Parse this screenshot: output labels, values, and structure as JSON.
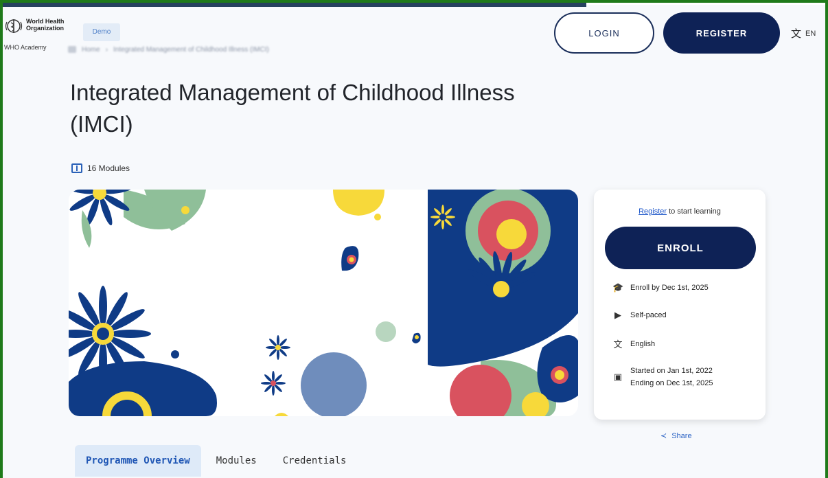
{
  "header": {
    "org_line1": "World Health",
    "org_line2": "Organization",
    "academy": "WHO Academy",
    "badge": "Demo",
    "breadcrumb": [
      "Home",
      "Integrated Management of Childhood Illness (IMCI)"
    ],
    "login": "LOGIN",
    "register": "REGISTER",
    "language": "EN"
  },
  "course": {
    "title": "Integrated Management of Childhood Illness (IMCI)",
    "modules": "16 Modules"
  },
  "card": {
    "register_link": "Register",
    "register_suffix": " to start learning",
    "enroll": "ENROLL",
    "enroll_by": "Enroll by Dec 1st, 2025",
    "pace": "Self-paced",
    "language": "English",
    "started": "Started on Jan 1st, 2022",
    "ending": "Ending on Dec 1st, 2025"
  },
  "share": "Share",
  "tabs": [
    "Programme Overview",
    "Modules",
    "Credentials"
  ],
  "colors": {
    "navy": "#0e2256",
    "blue_accent": "#2b62b8",
    "hero_navy": "#0f3b86",
    "hero_green": "#8fbf99",
    "hero_red": "#d9525f",
    "hero_yellow": "#f7d93a",
    "hero_slate": "#6f8dbc"
  }
}
